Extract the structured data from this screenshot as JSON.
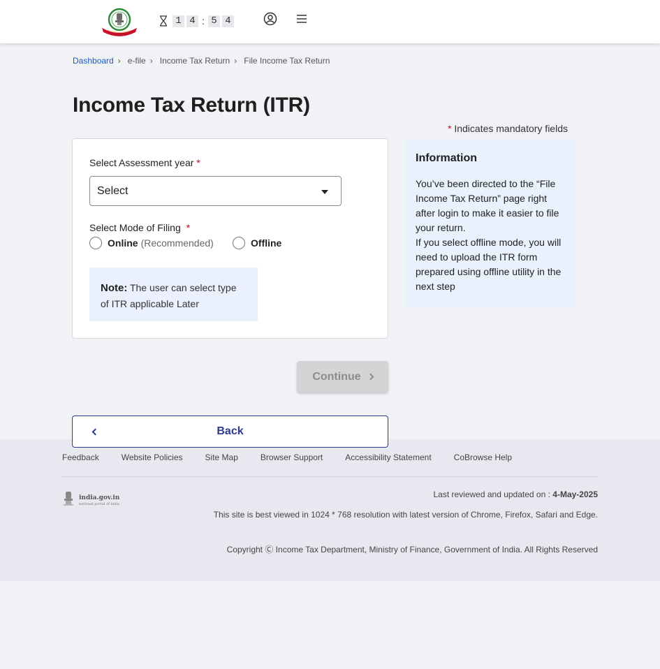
{
  "header": {
    "timer": {
      "digits": [
        "1",
        "4",
        "5",
        "4"
      ],
      "separator": ":"
    },
    "logo_icon": "income-tax-department-emblem",
    "profile_icon": "user-circle-icon",
    "menu_icon": "hamburger-menu-icon"
  },
  "breadcrumb": [
    {
      "label": "Dashboard",
      "link": true
    },
    {
      "label": "e-file",
      "link": false
    },
    {
      "label": "Income Tax Return",
      "link": false
    },
    {
      "label": "File Income Tax Return",
      "link": false
    }
  ],
  "page": {
    "title": "Income Tax Return (ITR)",
    "mandatory_asterisk": "*",
    "mandatory_text": "Indicates mandatory fields"
  },
  "form": {
    "assessment_year_label": "Select Assessment year",
    "required_mark": "*",
    "assessment_year_value": "Select",
    "mode_label": "Select Mode of Filing",
    "online_label": "Online",
    "online_sub": "(Recommended)",
    "offline_label": "Offline",
    "note_head": "Note:",
    "note_text": "The user can select type of ITR applicable Later"
  },
  "info": {
    "title": "Information",
    "text_1": "You’ve been directed to the “File Income Tax Return” page right after login to make it easier to file your return.",
    "text_2": "If you select offline mode, you will need to upload the ITR form prepared using offline utility in the next step"
  },
  "actions": {
    "continue_label": "Continue",
    "back_label": "Back"
  },
  "footer": {
    "links": [
      "Feedback",
      "Website Policies",
      "Site Map",
      "Browser Support",
      "Accessibility Statement",
      "CoBrowse Help"
    ],
    "india_gov": "india.gov.in",
    "india_gov_sub": "national portal of india",
    "last_reviewed_prefix": "Last reviewed and updated on :",
    "last_reviewed_date": "4-May-2025",
    "best_viewed": "This site is best viewed in 1024 * 768 resolution with latest version of Chrome, Firefox, Safari and Edge.",
    "copyright": "Copyright Ⓒ Income Tax Department, Ministry of Finance, Government of India. All Rights Reserved"
  },
  "colors": {
    "link_blue": "#1a5bbf",
    "back_navy": "#2b3a8f",
    "required_red": "#d0021b",
    "info_bg": "#e9f1fc"
  }
}
